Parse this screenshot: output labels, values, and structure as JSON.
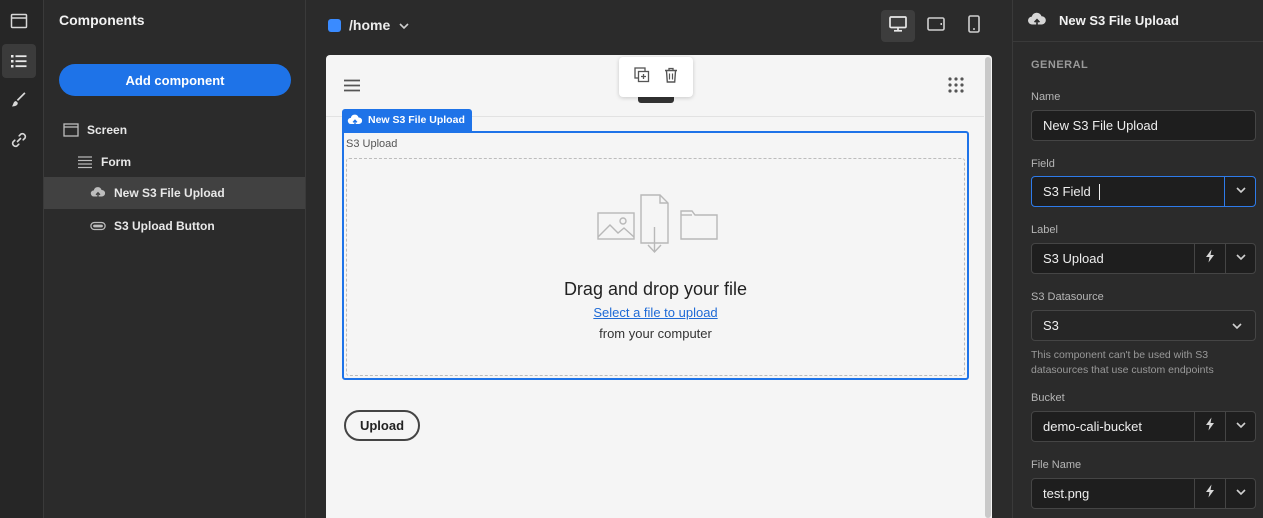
{
  "components_panel": {
    "title": "Components",
    "add_button": "Add component",
    "tree": [
      {
        "label": "Screen",
        "icon": "screen-icon"
      },
      {
        "label": "Form",
        "icon": "form-icon"
      },
      {
        "label": "New S3 File Upload",
        "icon": "cloud-upload-icon",
        "selected": true
      },
      {
        "label": "S3 Upload Button",
        "icon": "button-icon"
      }
    ]
  },
  "topbar": {
    "route": "/home",
    "route_color": "#3a8bff"
  },
  "canvas": {
    "selected_tag": "New S3 File Upload",
    "field_label": "S3 Upload",
    "dropzone_title": "Drag and drop your file",
    "dropzone_link": "Select a file to upload",
    "dropzone_sub": "from your computer",
    "upload_button": "Upload"
  },
  "settings": {
    "title": "New S3 File Upload",
    "section": "GENERAL",
    "fields": {
      "name": {
        "label": "Name",
        "value": "New S3 File Upload"
      },
      "field": {
        "label": "Field",
        "value": "S3 Field"
      },
      "label": {
        "label": "Label",
        "value": "S3 Upload"
      },
      "datasource": {
        "label": "S3 Datasource",
        "value": "S3"
      },
      "bucket": {
        "label": "Bucket",
        "value": "demo-cali-bucket"
      },
      "file_name": {
        "label": "File Name",
        "value": "test.png"
      }
    },
    "datasource_note": "This component can't be used with S3 datasources that use custom endpoints"
  },
  "colors": {
    "accent": "#1e73e8",
    "panel_bg": "#2b2b2b",
    "canvas_bg": "#f5f5f5"
  }
}
